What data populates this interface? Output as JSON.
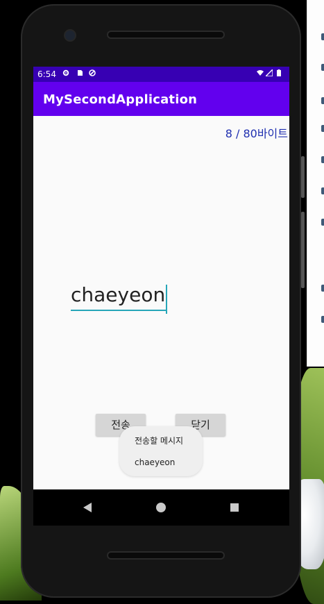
{
  "status_bar": {
    "time": "6:54"
  },
  "app_bar": {
    "title": "MySecondApplication"
  },
  "byte_counter": {
    "text": "8 / 80바이트"
  },
  "input": {
    "value": "chaeyeon"
  },
  "buttons": {
    "send_label": "전송",
    "close_label": "닫기"
  },
  "toast": {
    "title": "전송할 메시지",
    "message": "chaeyeon"
  },
  "colors": {
    "status_bar": "#3700b3",
    "app_bar": "#6200ee",
    "accent": "#26a6b8"
  }
}
